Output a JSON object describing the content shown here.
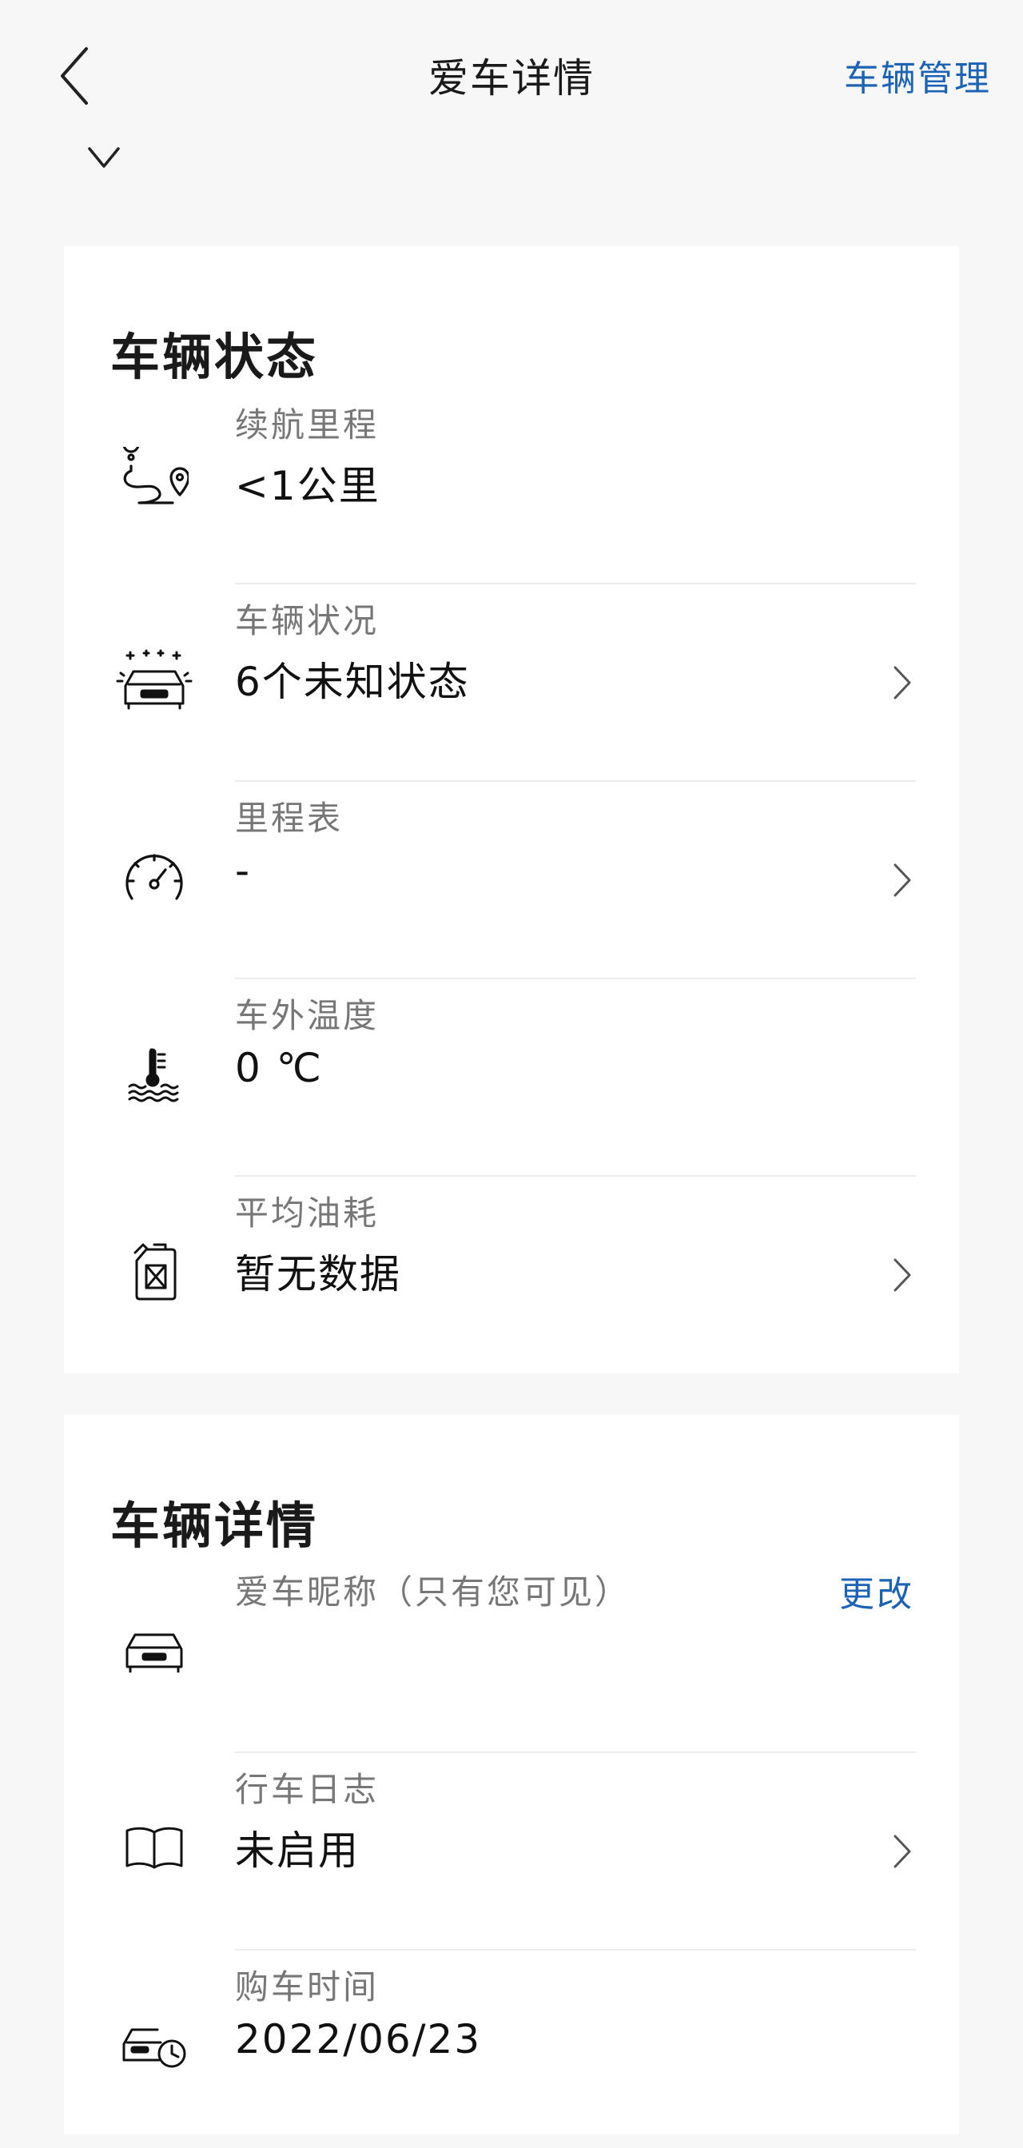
{
  "header": {
    "title": "爱车详情",
    "manage_label": "车辆管理"
  },
  "status_card": {
    "title": "车辆状态",
    "items": [
      {
        "label": "续航里程",
        "value": "<1公里",
        "icon": "route-icon",
        "has_arrow": false
      },
      {
        "label": "车辆状况",
        "value": "6个未知状态",
        "icon": "car-status-icon",
        "has_arrow": true
      },
      {
        "label": "里程表",
        "value": "-",
        "icon": "speedometer-icon",
        "has_arrow": true
      },
      {
        "label": "车外温度",
        "value": "0 ℃",
        "icon": "thermometer-icon",
        "has_arrow": false
      },
      {
        "label": "平均油耗",
        "value": "暂无数据",
        "icon": "fuel-can-icon",
        "has_arrow": true
      }
    ]
  },
  "detail_card": {
    "title": "车辆详情",
    "items": [
      {
        "label": "爱车昵称（只有您可见）",
        "value": "",
        "icon": "car-icon",
        "action": "更改"
      },
      {
        "label": "行车日志",
        "value": "未启用",
        "icon": "book-icon",
        "has_arrow": true
      },
      {
        "label": "购车时间",
        "value": "2022/06/23",
        "icon": "car-clock-icon",
        "has_arrow": false
      }
    ]
  },
  "colors": {
    "accent": "#1d63b5",
    "background": "#f7f7f7",
    "card": "#ffffff",
    "label": "#777777"
  }
}
